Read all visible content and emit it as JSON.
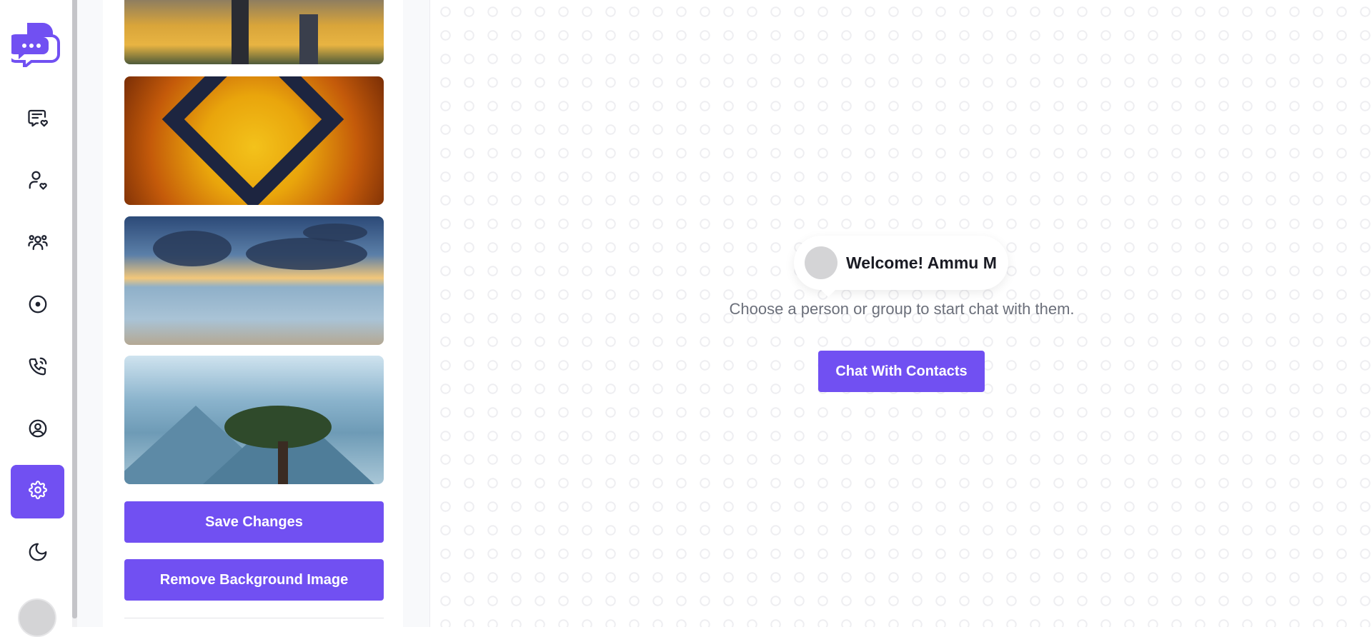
{
  "sidebar": {
    "logo_icon": "chat-bubbles-logo-icon",
    "nav": [
      {
        "id": "chats",
        "icon": "message-heart-icon",
        "active": false
      },
      {
        "id": "contacts",
        "icon": "user-heart-icon",
        "active": false
      },
      {
        "id": "groups",
        "icon": "users-group-icon",
        "active": false
      },
      {
        "id": "status",
        "icon": "circle-dot-icon",
        "active": false
      },
      {
        "id": "calls",
        "icon": "phone-call-icon",
        "active": false
      },
      {
        "id": "profile",
        "icon": "user-circle-icon",
        "active": false
      },
      {
        "id": "settings",
        "icon": "gear-icon",
        "active": true
      },
      {
        "id": "theme",
        "icon": "moon-icon",
        "active": false
      }
    ]
  },
  "settings_panel": {
    "backgrounds": [
      "city-sunset",
      "autumn-leaves-frame",
      "sea-sunset-clouds",
      "mountain-pine-tree"
    ],
    "save_label": "Save Changes",
    "remove_label": "Remove Background Image"
  },
  "welcome": {
    "greeting": "Welcome! Ammu M",
    "subtitle": "Choose a person or group to start chat with them.",
    "cta_label": "Chat With Contacts"
  },
  "colors": {
    "accent": "#7150f2",
    "text_dark": "#1a1b24",
    "text_muted": "#6b6f7a"
  }
}
